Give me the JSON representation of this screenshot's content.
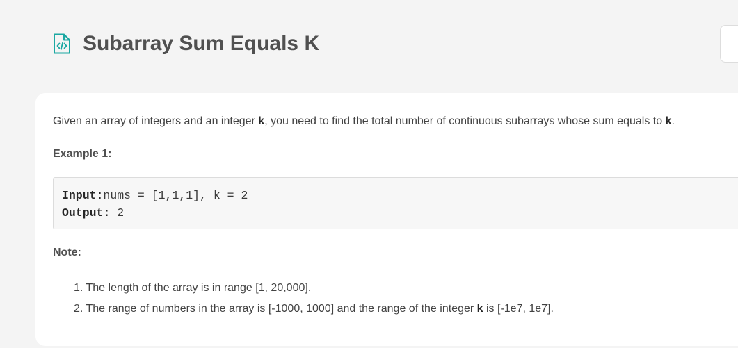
{
  "header": {
    "title": "Subarray Sum Equals K",
    "icon": "file-code-icon",
    "accent_color": "#1ba8a2"
  },
  "problem": {
    "description": {
      "part1": "Given an array of integers and an integer ",
      "k1": "k",
      "part2": ", you need to find the total number of continuous subarrays whose sum equals to ",
      "k2": "k",
      "part3": "."
    },
    "example_heading": "Example 1:",
    "example": {
      "input_label": "Input:",
      "input_value": "nums = [1,1,1], k = 2",
      "output_label": "Output:",
      "output_value": " 2"
    },
    "note_heading": "Note:",
    "notes": [
      {
        "number": "1.",
        "text": "The length of the array is in range [1, 20,000]."
      },
      {
        "number": "2.",
        "text_before": "The range of numbers in the array is [-1000, 1000] and the range of the integer ",
        "bold": "k",
        "text_after": " is [-1e7, 1e7]."
      }
    ]
  }
}
